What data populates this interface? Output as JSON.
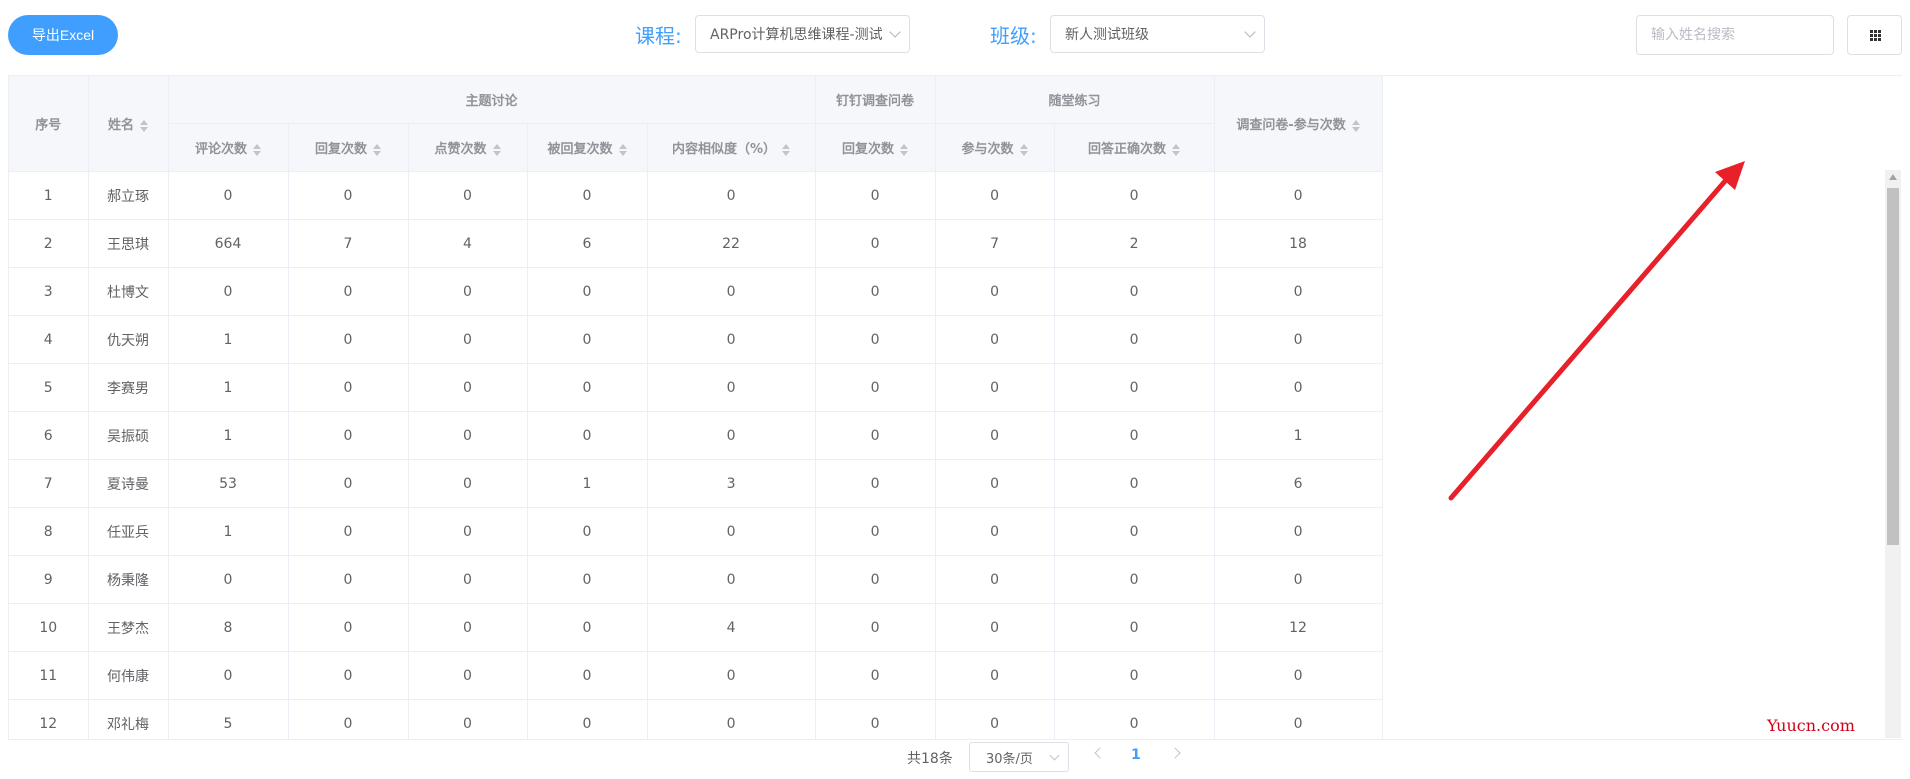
{
  "toolbar": {
    "export_label": "导出Excel",
    "course_label": "课程:",
    "course_value": "ARPro计算机思维课程-测试",
    "class_label": "班级:",
    "class_value": "新人测试班级",
    "search_placeholder": "输入姓名搜索"
  },
  "table": {
    "group_headers": {
      "index": "序号",
      "name": "姓名",
      "topic": "主题讨论",
      "dingtalk": "钉钉调查问卷",
      "practice": "随堂练习",
      "survey": "调查问卷-参与次数"
    },
    "sub_headers": [
      "评论次数",
      "回复次数",
      "点赞次数",
      "被回复次数",
      "内容相似度（%）",
      "回复次数",
      "参与次数",
      "回答正确次数"
    ],
    "rows": [
      [
        "1",
        "郝立琢",
        "0",
        "0",
        "0",
        "0",
        "0",
        "0",
        "0",
        "0",
        "0"
      ],
      [
        "2",
        "王思琪",
        "664",
        "7",
        "4",
        "6",
        "22",
        "0",
        "7",
        "2",
        "18"
      ],
      [
        "3",
        "杜博文",
        "0",
        "0",
        "0",
        "0",
        "0",
        "0",
        "0",
        "0",
        "0"
      ],
      [
        "4",
        "仇天朔",
        "1",
        "0",
        "0",
        "0",
        "0",
        "0",
        "0",
        "0",
        "0"
      ],
      [
        "5",
        "李赛男",
        "1",
        "0",
        "0",
        "0",
        "0",
        "0",
        "0",
        "0",
        "0"
      ],
      [
        "6",
        "吴振硕",
        "1",
        "0",
        "0",
        "0",
        "0",
        "0",
        "0",
        "0",
        "1"
      ],
      [
        "7",
        "夏诗曼",
        "53",
        "0",
        "0",
        "1",
        "3",
        "0",
        "0",
        "0",
        "6"
      ],
      [
        "8",
        "任亚兵",
        "1",
        "0",
        "0",
        "0",
        "0",
        "0",
        "0",
        "0",
        "0"
      ],
      [
        "9",
        "杨秉隆",
        "0",
        "0",
        "0",
        "0",
        "0",
        "0",
        "0",
        "0",
        "0"
      ],
      [
        "10",
        "王梦杰",
        "8",
        "0",
        "0",
        "0",
        "4",
        "0",
        "0",
        "0",
        "12"
      ],
      [
        "11",
        "何伟康",
        "0",
        "0",
        "0",
        "0",
        "0",
        "0",
        "0",
        "0",
        "0"
      ],
      [
        "12",
        "邓礼梅",
        "5",
        "0",
        "0",
        "0",
        "0",
        "0",
        "0",
        "0",
        "0"
      ]
    ]
  },
  "pagination": {
    "total": "共18条",
    "page_size": "30条/页",
    "current_page": "1"
  },
  "watermark": "Yuucn.com",
  "colors": {
    "accent": "#409eff",
    "arrow": "#e8202a"
  }
}
